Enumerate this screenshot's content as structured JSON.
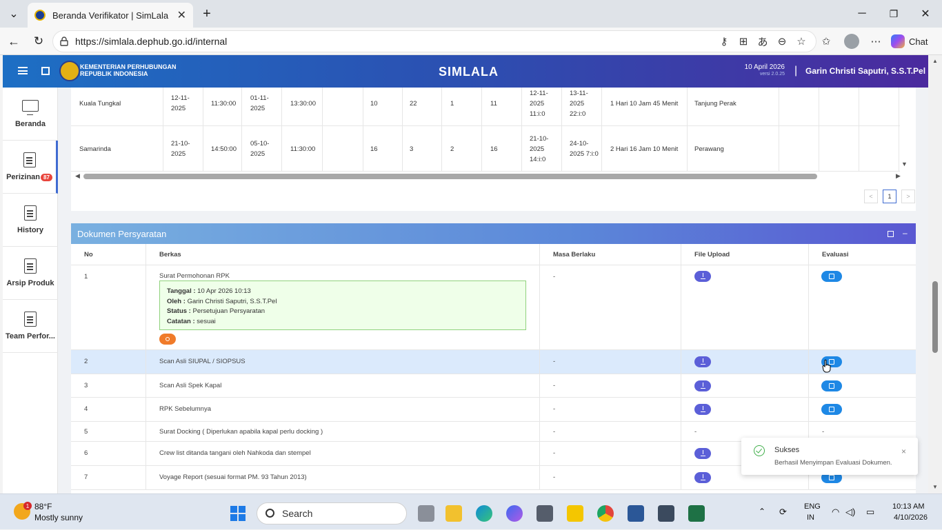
{
  "browser": {
    "tab_title": "Beranda Verifikator | SimLala",
    "url": "https://simlala.dephub.go.id/internal",
    "chat_label": "Chat"
  },
  "header": {
    "ministry_line1": "KEMENTERIAN PERHUBUNGAN",
    "ministry_line2": "REPUBLIK INDONESIA",
    "app_title": "SIMLALA",
    "date": "10 April 2026",
    "version": "versi 2.0.25",
    "separator": "|",
    "user": "Garin Christi Saputri, S.S.T.Pel"
  },
  "sidebar": {
    "items": [
      {
        "label": "Beranda"
      },
      {
        "label": "Perizinan",
        "badge": "87"
      },
      {
        "label": "History"
      },
      {
        "label": "Arsip Produk"
      },
      {
        "label": "Team Perfor..."
      }
    ]
  },
  "schedule_table": {
    "rows": [
      {
        "port": "Kuala Tungkal",
        "date1": "12-11-2025",
        "time1": "11:30:00",
        "date2": "01-11-2025",
        "time2": "13:30:00",
        "blank": "",
        "n1": "10",
        "n2": "22",
        "n3": "1",
        "n4": "11",
        "start": "12-11-2025 11:i:0",
        "end": "13-11-2025 22:i:0",
        "duration": "1 Hari 10 Jam 45 Menit",
        "dest": "Tanjung Perak"
      },
      {
        "port": "Samarinda",
        "date1": "21-10-2025",
        "time1": "14:50:00",
        "date2": "05-10-2025",
        "time2": "11:30:00",
        "blank": "",
        "n1": "16",
        "n2": "3",
        "n3": "2",
        "n4": "16",
        "start": "21-10-2025 14:i:0",
        "end": "24-10-2025 7:i:0",
        "duration": "2 Hari 16 Jam 10 Menit",
        "dest": "Perawang"
      }
    ],
    "pagination": {
      "prev": "<",
      "current": "1",
      "next": ">"
    }
  },
  "dokumen": {
    "title": "Dokumen Persyaratan",
    "columns": {
      "no": "No",
      "berkas": "Berkas",
      "masa": "Masa Berlaku",
      "file": "File Upload",
      "evaluasi": "Evaluasi"
    },
    "note": {
      "tanggal_label": "Tanggal :",
      "tanggal": "10 Apr 2026 10:13",
      "oleh_label": "Oleh :",
      "oleh": "Garin Christi Saputri, S.S.T.Pel",
      "status_label": "Status :",
      "status": "Persetujuan Persyaratan",
      "catatan_label": "Catatan :",
      "catatan": "sesuai"
    },
    "rows": [
      {
        "no": "1",
        "berkas": "Surat Permohonan RPK",
        "masa": "-",
        "file": "",
        "evaluasi": ""
      },
      {
        "no": "2",
        "berkas": "Scan Asli SIUPAL / SIOPSUS",
        "masa": "-",
        "file": "",
        "evaluasi": ""
      },
      {
        "no": "3",
        "berkas": "Scan Asli Spek Kapal",
        "masa": "-",
        "file": "",
        "evaluasi": ""
      },
      {
        "no": "4",
        "berkas": "RPK Sebelumnya",
        "masa": "-",
        "file": "",
        "evaluasi": ""
      },
      {
        "no": "5",
        "berkas": "Surat Docking ( Diperlukan apabila kapal perlu docking )",
        "masa": "-",
        "file": "-",
        "evaluasi": "-"
      },
      {
        "no": "6",
        "berkas": "Crew list ditanda tangani oleh Nahkoda dan stempel",
        "masa": "-",
        "file": "",
        "evaluasi": ""
      },
      {
        "no": "7",
        "berkas": "Voyage Report (sesuai format PM. 93 Tahun 2013)",
        "masa": "-",
        "file": "",
        "evaluasi": ""
      }
    ]
  },
  "toast": {
    "title": "Sukses",
    "message": "Berhasil Menyimpan Evaluasi Dokumen.",
    "close": "×"
  },
  "taskbar": {
    "notif_count": "1",
    "temperature": "88°F",
    "condition": "Mostly sunny",
    "search_placeholder": "Search",
    "lang1": "ENG",
    "lang2": "IN",
    "time": "10:13 AM",
    "date": "4/10/2026"
  }
}
